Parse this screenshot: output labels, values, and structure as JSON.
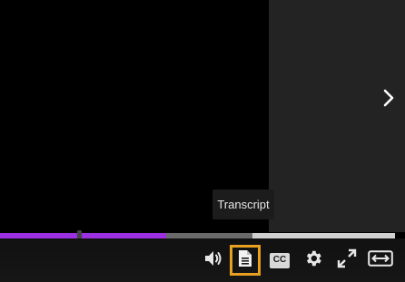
{
  "tooltip": {
    "text": "Transcript"
  },
  "progress": {
    "played_fraction": 0.42,
    "buffered_fraction": 0.64,
    "marker_fraction": 0.195
  },
  "controls": {
    "cc_label": "CC",
    "buttons": [
      "volume-icon",
      "transcript-icon",
      "closed-captions-icon",
      "settings-gear-icon",
      "fullscreen-icon",
      "wide-view-icon"
    ]
  },
  "colors": {
    "progress_played": "#9b30e0",
    "progress_buffered": "#6a6a6a",
    "progress_track": "#cfcfcf",
    "focus_outline": "#e7a021",
    "side_panel": "#232323"
  }
}
